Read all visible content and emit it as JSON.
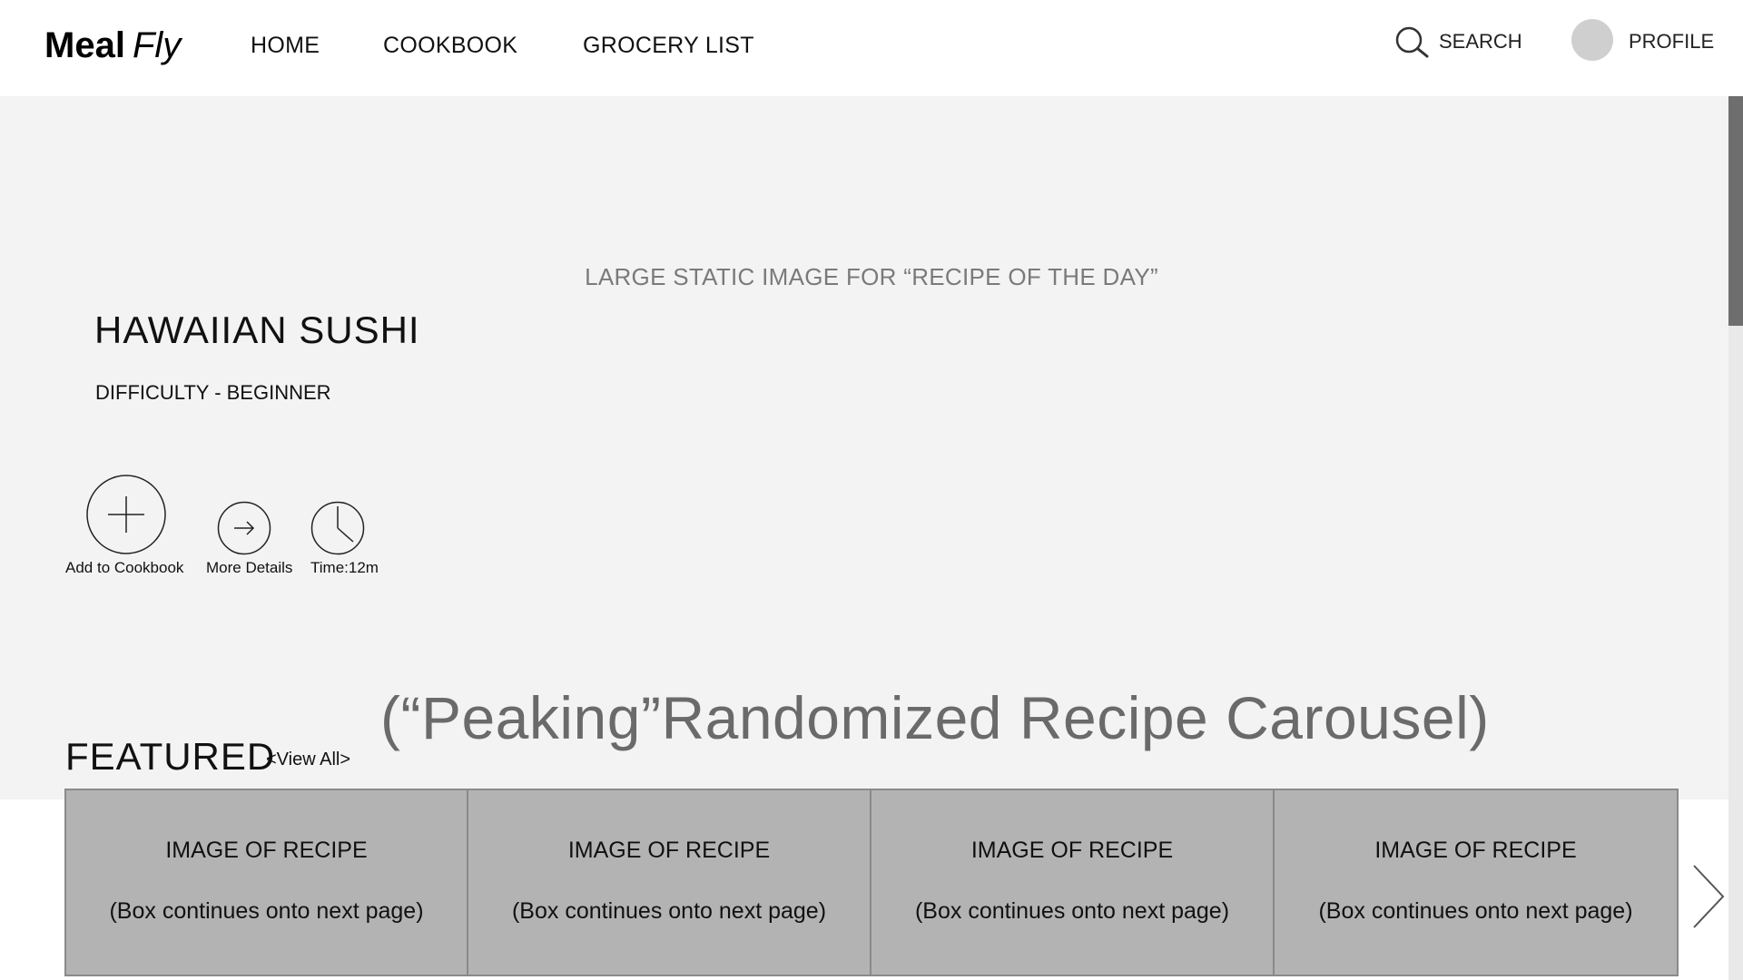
{
  "header": {
    "logo_bold": "Meal",
    "logo_italic": "Fly",
    "nav": [
      {
        "label": "HOME"
      },
      {
        "label": "COOKBOOK"
      },
      {
        "label": "GROCERY LIST"
      }
    ],
    "search_label": "SEARCH",
    "profile_label": "PROFILE"
  },
  "hero": {
    "image_caption": "LARGE STATIC IMAGE FOR “RECIPE OF THE DAY”",
    "recipe_title": "HAWAIIAN SUSHI",
    "difficulty": "DIFFICULTY - BEGINNER",
    "actions": [
      {
        "label": "Add to Cookbook",
        "icon": "plus-circle-icon"
      },
      {
        "label": "More Details",
        "icon": "arrow-right-circle-icon"
      },
      {
        "label": "Time:12m",
        "icon": "clock-icon"
      }
    ]
  },
  "featured": {
    "carousel_note": "(“Peaking”Randomized Recipe Carousel)",
    "title": "FEATURED",
    "view_all": "<View All>",
    "cards": [
      {
        "title": "IMAGE OF RECIPE",
        "subtitle": "(Box continues onto next page)"
      },
      {
        "title": "IMAGE OF RECIPE",
        "subtitle": "(Box continues onto next page)"
      },
      {
        "title": "IMAGE OF RECIPE",
        "subtitle": "(Box continues onto next page)"
      },
      {
        "title": "IMAGE OF RECIPE",
        "subtitle": "(Box continues onto next page)"
      }
    ]
  },
  "colors": {
    "hero_background": "#f3f3f3",
    "card_background": "#b3b3b3",
    "card_border": "#8a8a8a",
    "muted_text": "#7a7a7a",
    "avatar": "#cfcfcf",
    "scroll_thumb": "#6e6e6e"
  }
}
